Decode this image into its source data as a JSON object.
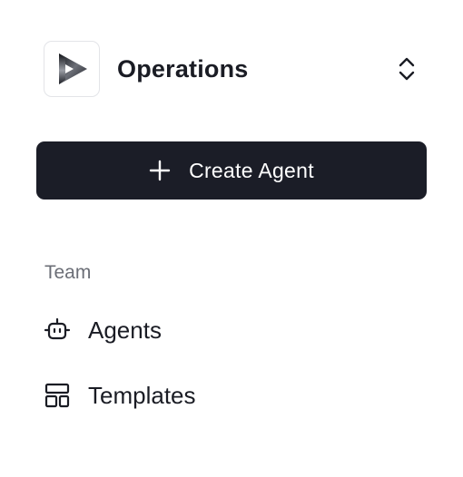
{
  "workspace": {
    "name": "Operations",
    "logo_icon": "play-logo-icon",
    "switch_icon": "chevron-up-down-icon"
  },
  "actions": {
    "create_agent_label": "Create Agent",
    "create_agent_icon": "plus-icon"
  },
  "nav": {
    "section_label": "Team",
    "items": [
      {
        "label": "Agents",
        "icon": "robot-icon"
      },
      {
        "label": "Templates",
        "icon": "layout-template-icon"
      }
    ]
  },
  "colors": {
    "button_bg": "#1b1d27",
    "text_primary": "#1a1c24",
    "text_muted": "#6b6e76",
    "border": "#e3e4e8"
  }
}
